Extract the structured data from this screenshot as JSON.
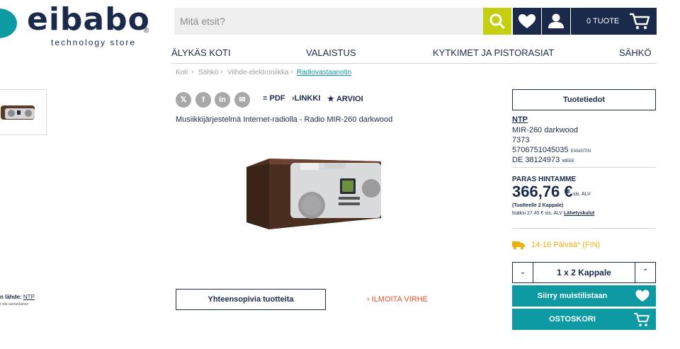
{
  "brand": {
    "name": "eibabo",
    "tagline": "technology store",
    "reg": "®"
  },
  "search": {
    "placeholder": "Mitä etsit?"
  },
  "header": {
    "cart_label": "0 TUOTE"
  },
  "nav": [
    "ÄLYKÄS KOTI",
    "VALAISTUS",
    "KYTKIMET JA PISTORASIAT",
    "SÄHKÖ"
  ],
  "breadcrumb": [
    "Koti",
    "Sähkö",
    "Viihde-elektroniikka",
    "Radiovastaanotin"
  ],
  "share": {
    "x": "𝕏",
    "facebook": "f",
    "linkedin": "in",
    "mail": "✉"
  },
  "actions": {
    "pdf": "PDF",
    "link": "LINKKI",
    "review": "ARVIOI"
  },
  "product": {
    "title": "Musiikkijärjestelmä Internet-radiolla - Radio MIR-260 darkwood",
    "compat_button": "Yhteensopivia tuotteita",
    "report": "ILMOITA VIRHE",
    "source_label": "n lähde:",
    "source_value": "NTP",
    "source_note": "t olla samanlainen"
  },
  "info": {
    "button": "Tuotetiedot",
    "brand": "NTP",
    "model": "MIR-260 darkwood",
    "number": "7373",
    "ean": "5706751045035",
    "ean_label": "EAN/GTIN",
    "weee": "DE 38124973",
    "weee_label": "WEEE"
  },
  "price": {
    "label": "PARAS HINTAMME",
    "value": "366,76 €",
    "vat": "sis. ALV",
    "qty_note": "(Tuotteelle 2 Kappale)",
    "ship_prefix": "lisäksi 27,45 € sis. ALV",
    "ship_link": "Lähetyskulut"
  },
  "delivery": {
    "text": "14-16 Päivää* (FIN)"
  },
  "quantity": {
    "value": "1 x 2 Kappale"
  },
  "buttons": {
    "wishlist": "Siirry muistilistaan",
    "cart": "OSTOSKORI"
  },
  "colors": {
    "navy": "#1b2a4a",
    "teal": "#0e9aa3",
    "lime": "#c5cf12",
    "orange": "#e0532c",
    "yellow": "#e8b40c"
  }
}
